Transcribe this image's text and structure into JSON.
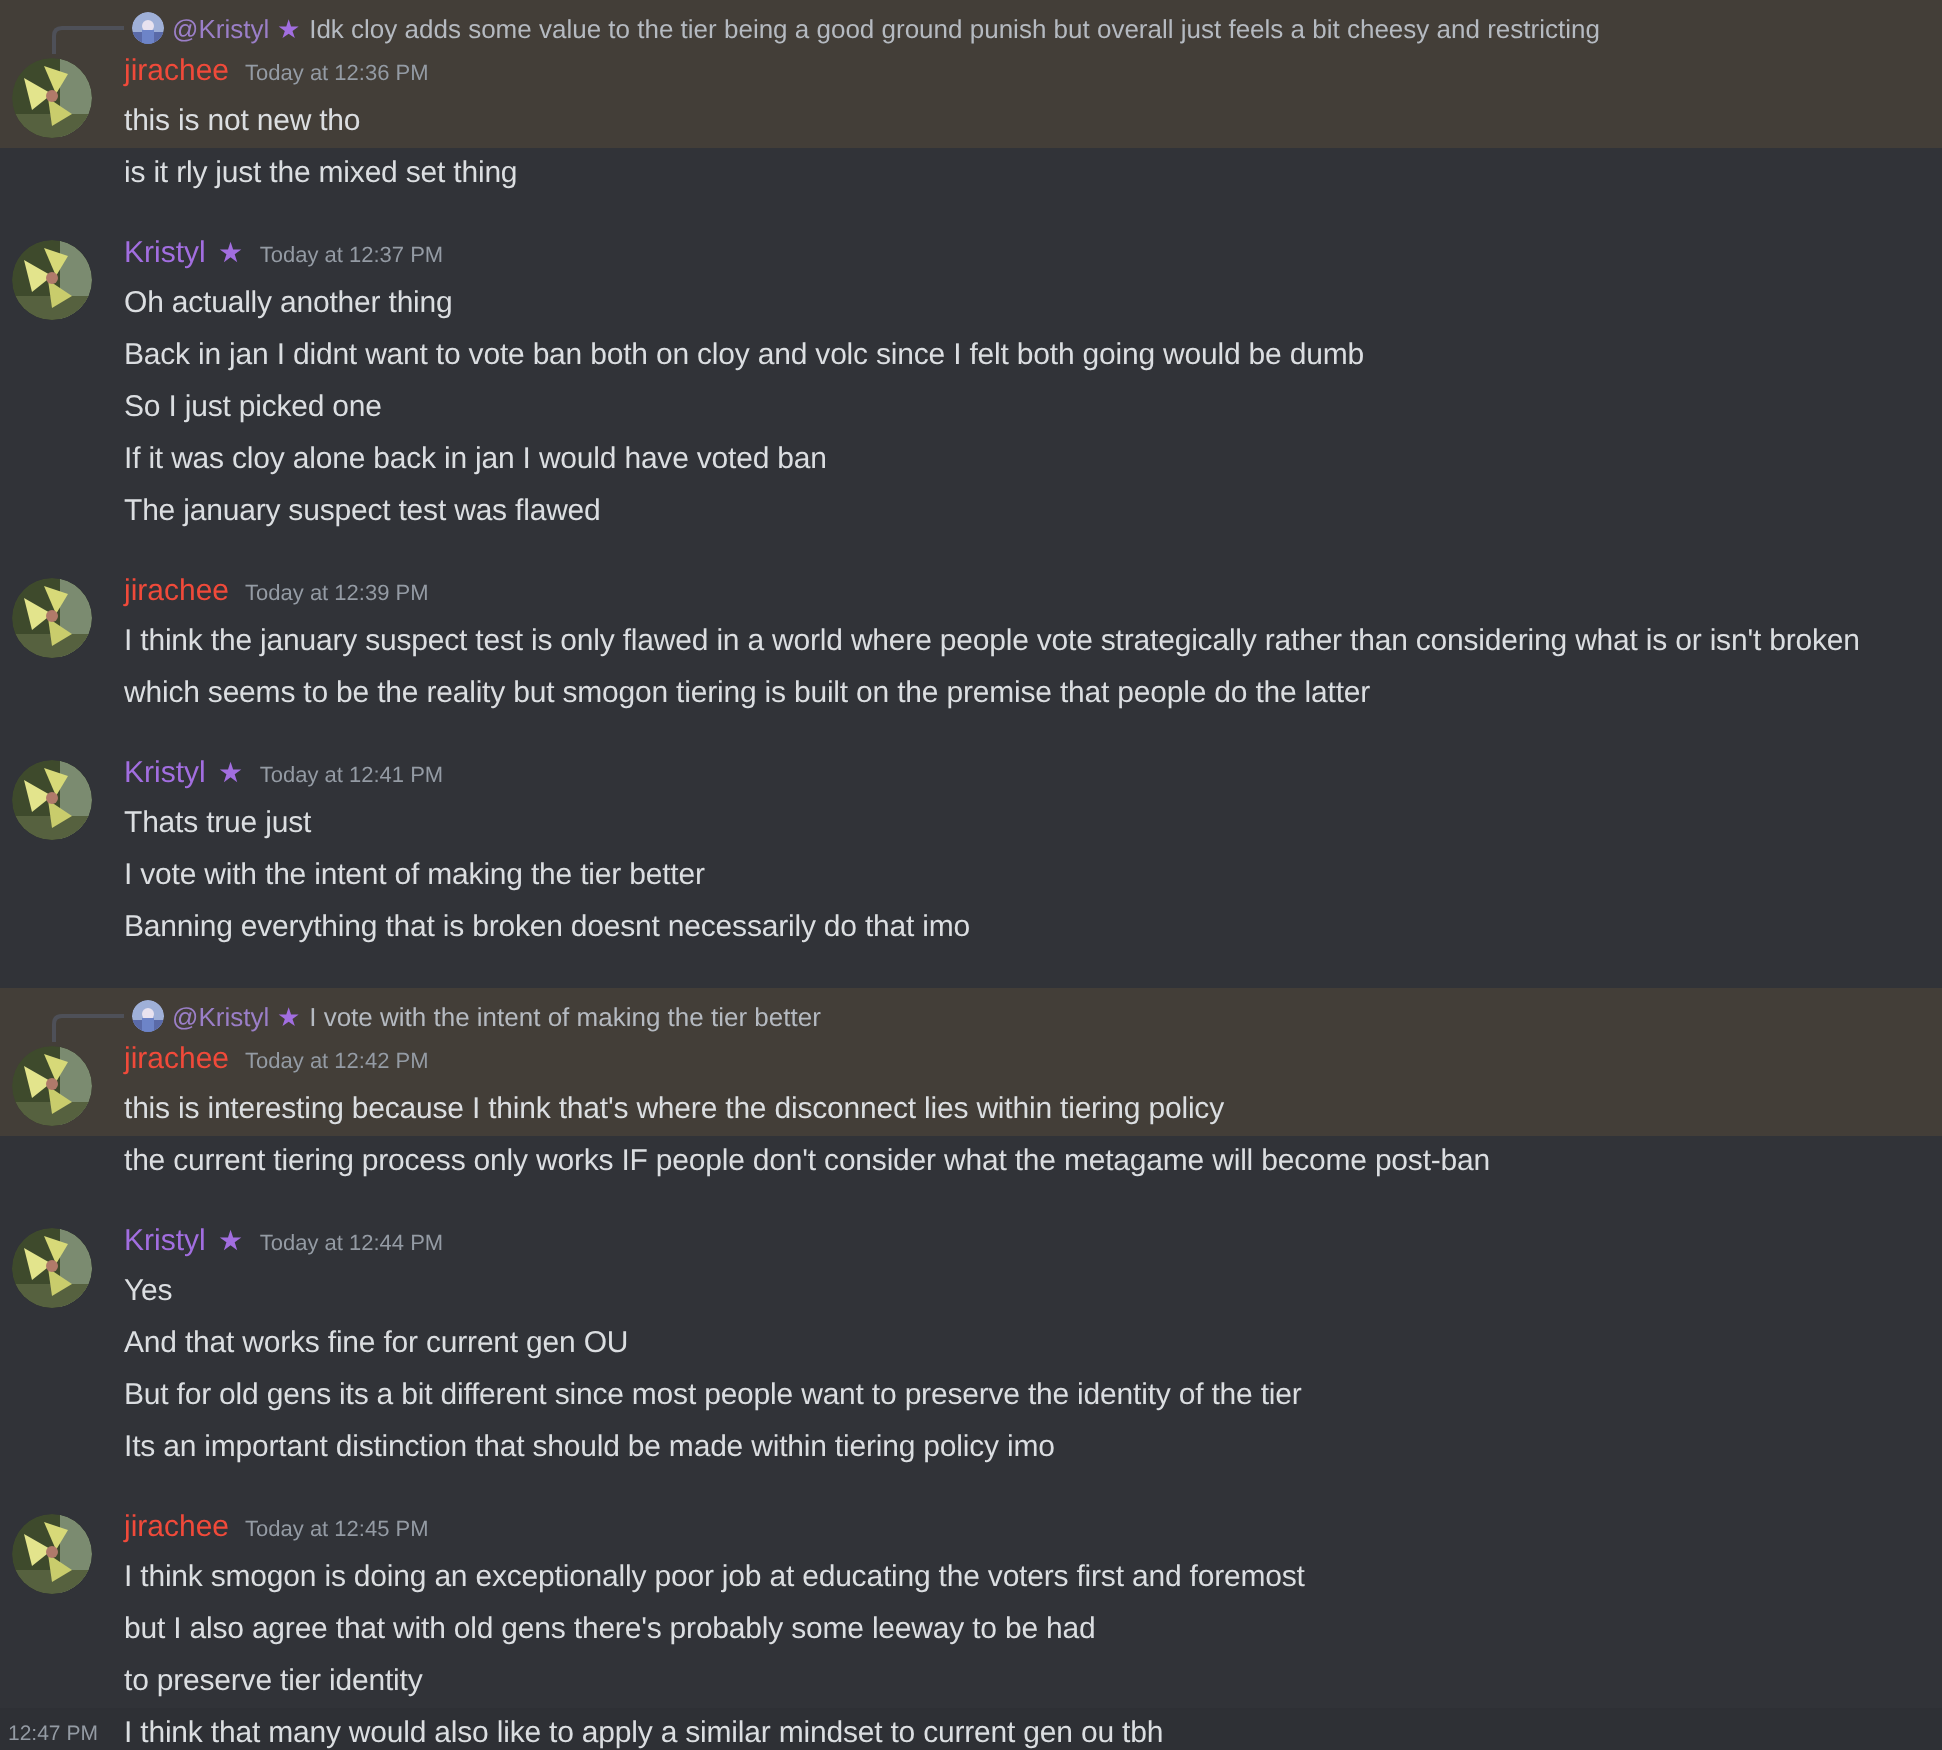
{
  "groups": [
    {
      "author": "jirachee",
      "color": "#f04a3a",
      "reply": {
        "author": "@Kristyl",
        "star": "★",
        "text": "Idk cloy adds some value to the tier being a good ground punish but overall just feels a bit cheesy and restricting"
      },
      "time": "Today at 12:36 PM",
      "messages": [
        {
          "text": "this is not new tho",
          "highlighted": true
        },
        {
          "text": "is it rly just the mixed set thing",
          "highlighted": false
        }
      ]
    },
    {
      "author": "Kristyl",
      "color": "#a26ee0",
      "star": "★",
      "time": "Today at 12:37 PM",
      "messages": [
        {
          "text": "Oh actually another thing",
          "highlighted": false
        },
        {
          "text": "Back in jan I didnt want to vote ban both on cloy and volc since I felt both going would be dumb",
          "highlighted": false
        },
        {
          "text": "So I just picked one",
          "highlighted": false
        },
        {
          "text": "If it was cloy alone back in jan I would have voted ban",
          "highlighted": false
        },
        {
          "text": "The january suspect test was flawed",
          "highlighted": false
        }
      ]
    },
    {
      "author": "jirachee",
      "color": "#f04a3a",
      "time": "Today at 12:39 PM",
      "messages": [
        {
          "text": "I think the january suspect test is only flawed in a world where people vote strategically rather than considering what is or isn't broken",
          "highlighted": false
        },
        {
          "text": "which seems to be the reality but smogon tiering is built on the premise that people do the latter",
          "highlighted": false
        }
      ]
    },
    {
      "author": "Kristyl",
      "color": "#a26ee0",
      "star": "★",
      "time": "Today at 12:41 PM",
      "messages": [
        {
          "text": "Thats true just",
          "highlighted": false
        },
        {
          "text": "I vote with the intent of making the tier better",
          "highlighted": false
        },
        {
          "text": "Banning everything that is broken doesnt necessarily do that imo",
          "highlighted": false
        }
      ]
    },
    {
      "author": "jirachee",
      "color": "#f04a3a",
      "reply": {
        "author": "@Kristyl",
        "star": "★",
        "text": "I vote with the intent of making the tier better"
      },
      "time": "Today at 12:42 PM",
      "messages": [
        {
          "text": "this is interesting because I think that's where the disconnect lies within tiering policy",
          "highlighted": true
        },
        {
          "text": "the current tiering process only works IF people don't consider what the metagame will become post-ban",
          "highlighted": false
        }
      ]
    },
    {
      "author": "Kristyl",
      "color": "#a26ee0",
      "star": "★",
      "time": "Today at 12:44 PM",
      "messages": [
        {
          "text": "Yes",
          "highlighted": false
        },
        {
          "text": "And that works fine for current gen OU",
          "highlighted": false
        },
        {
          "text": "But for old gens its a bit different since most people want to preserve the identity of the tier",
          "highlighted": false
        },
        {
          "text": "Its an important distinction that should be made within tiering policy imo",
          "highlighted": false
        }
      ]
    },
    {
      "author": "jirachee",
      "color": "#f04a3a",
      "time": "Today at 12:45 PM",
      "messages": [
        {
          "text": "I think smogon is doing an exceptionally poor job at educating the voters first and foremost",
          "highlighted": false
        },
        {
          "text": "but I also agree that with old gens there's probably some leeway to be had",
          "highlighted": false
        },
        {
          "text": "to preserve tier identity",
          "highlighted": false
        },
        {
          "text": "I think that many would also like to apply a similar mindset to current gen ou tbh",
          "highlighted": false,
          "hovered": true,
          "hover_time": "12:47 PM"
        }
      ]
    }
  ]
}
